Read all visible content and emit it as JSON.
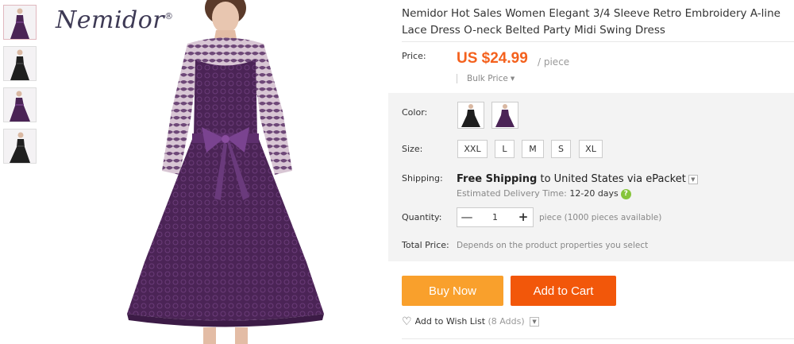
{
  "brand": {
    "name": "Nemidor",
    "mark": "®"
  },
  "product": {
    "title": "Nemidor Hot Sales Women Elegant 3/4 Sleeve Retro Embroidery A-line Lace Dress O-neck Belted Party Midi Swing Dress"
  },
  "thumbnails": [
    {
      "color": "#4a2455",
      "name": "purple-front"
    },
    {
      "color": "#1f1f1f",
      "name": "black-front"
    },
    {
      "color": "#4a2455",
      "name": "purple-side"
    },
    {
      "color": "#1f1f1f",
      "name": "black-side"
    }
  ],
  "price": {
    "label": "Price:",
    "value": "US $24.99",
    "unit": "/ piece",
    "bulk": "Bulk Price"
  },
  "color": {
    "label": "Color:",
    "options": [
      {
        "swatch": "#1e1e1e"
      },
      {
        "swatch": "#4b2456"
      }
    ]
  },
  "size": {
    "label": "Size:",
    "options": [
      "XXL",
      "L",
      "M",
      "S",
      "XL"
    ]
  },
  "shipping": {
    "label": "Shipping:",
    "free": "Free Shipping",
    "to": "to",
    "country": "United States",
    "via": "via",
    "method": "ePacket",
    "est_label": "Estimated Delivery Time:",
    "est_days": "12-20 days",
    "help": "?"
  },
  "quantity": {
    "label": "Quantity:",
    "value": "1",
    "minus": "—",
    "plus": "+",
    "note": "piece (1000 pieces available)"
  },
  "total": {
    "label": "Total Price:",
    "note": "Depends on the product properties you select"
  },
  "actions": {
    "buy": "Buy Now",
    "cart": "Add to Cart",
    "wish": "Add to Wish List",
    "wish_count": "(8 Adds)"
  },
  "colors": {
    "price": "#f4611d",
    "buy": "#f9a02c",
    "cart": "#f2570a",
    "dress_purple": "#4b2456"
  }
}
